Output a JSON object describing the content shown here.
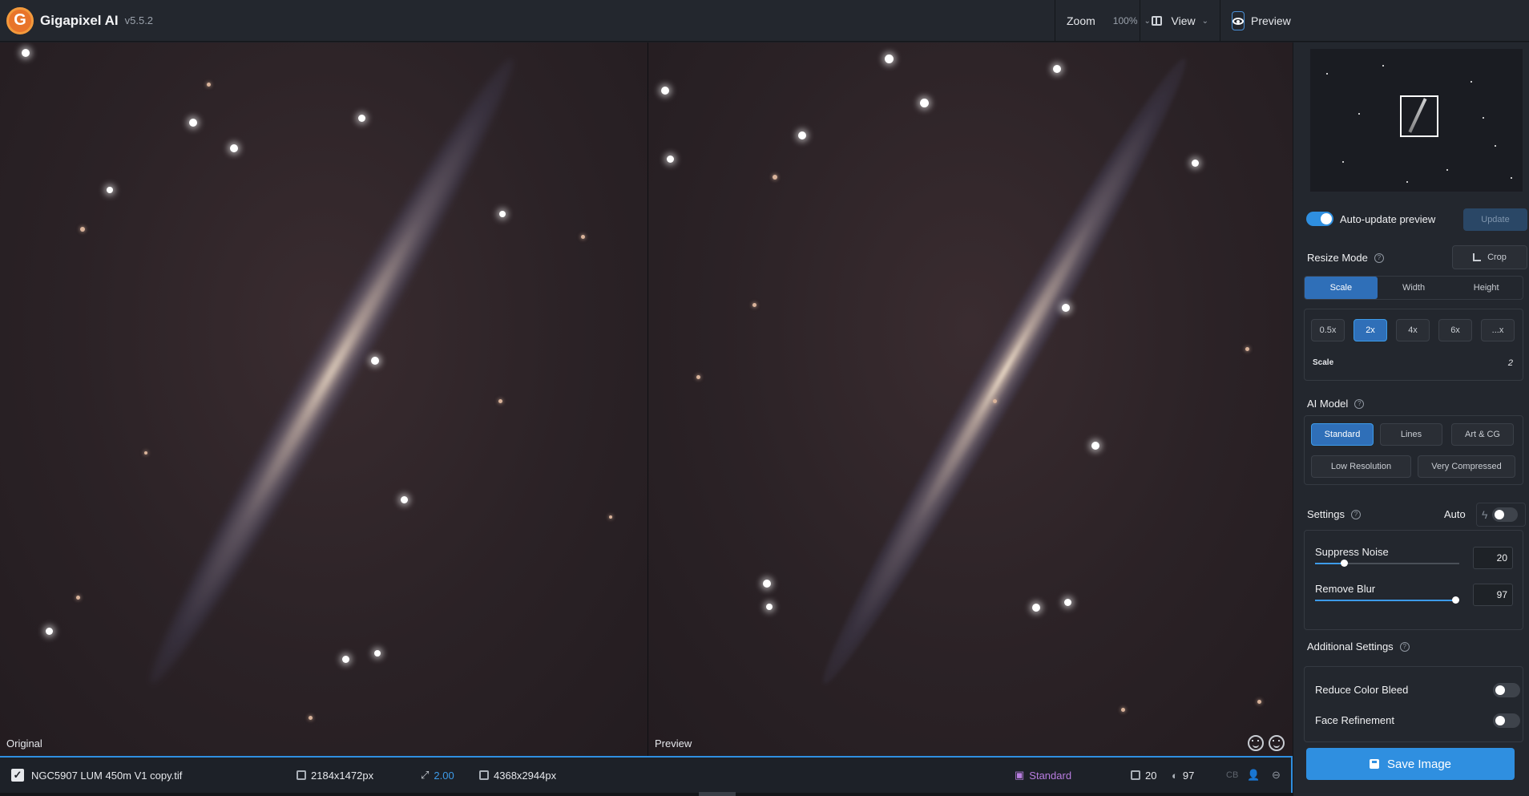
{
  "app": {
    "name": "Gigapixel AI",
    "version": "v5.5.2",
    "logo_letter": "G"
  },
  "toolbar": {
    "zoom_label": "Zoom",
    "zoom_value": "100%",
    "view_label": "View",
    "preview_label": "Preview"
  },
  "panes": {
    "original_label": "Original",
    "preview_label": "Preview"
  },
  "filebar": {
    "filename": "NGC5907 LUM 450m V1 copy.tif",
    "input_size": "2184x1472px",
    "scale": "2.00",
    "output_size": "4368x2944px",
    "model": "Standard",
    "noise_value": "20",
    "blur_value": "97",
    "cb_label": "CB"
  },
  "sidebar": {
    "auto_update_label": "Auto-update preview",
    "auto_update_on": true,
    "update_button": "Update",
    "resize_mode_title": "Resize Mode",
    "crop_button": "Crop",
    "resize_tabs": [
      "Scale",
      "Width",
      "Height"
    ],
    "resize_active": "Scale",
    "scale_options": [
      "0.5x",
      "2x",
      "4x",
      "6x",
      "...x"
    ],
    "scale_active": "2x",
    "scale_label": "Scale",
    "scale_value": "2",
    "ai_model_title": "AI Model",
    "models_row1": [
      "Standard",
      "Lines",
      "Art & CG"
    ],
    "models_row2": [
      "Low Resolution",
      "Very Compressed"
    ],
    "model_active": "Standard",
    "settings_title": "Settings",
    "auto_label": "Auto",
    "auto_on": false,
    "suppress_noise_label": "Suppress Noise",
    "suppress_noise_value": "20",
    "suppress_noise_level": 0.2,
    "remove_blur_label": "Remove Blur",
    "remove_blur_value": "97",
    "remove_blur_level": 0.97,
    "additional_title": "Additional Settings",
    "reduce_color_bleed_label": "Reduce Color Bleed",
    "reduce_color_bleed_on": false,
    "face_refinement_label": "Face Refinement",
    "face_refinement_on": false,
    "save_button": "Save Image"
  },
  "colors": {
    "accent": "#2f8fe0",
    "model_badge": "#b87de0",
    "scale_value": "#3d9be9"
  },
  "icons": [
    "gigapixel-logo",
    "view-layout-icon",
    "eye-icon",
    "face-icon",
    "checkbox-icon",
    "input-size-icon",
    "scale-icon",
    "output-size-icon",
    "model-icon",
    "noise-icon",
    "blur-icon",
    "crop-icon",
    "help-icon",
    "bolt-icon",
    "save-icon"
  ]
}
